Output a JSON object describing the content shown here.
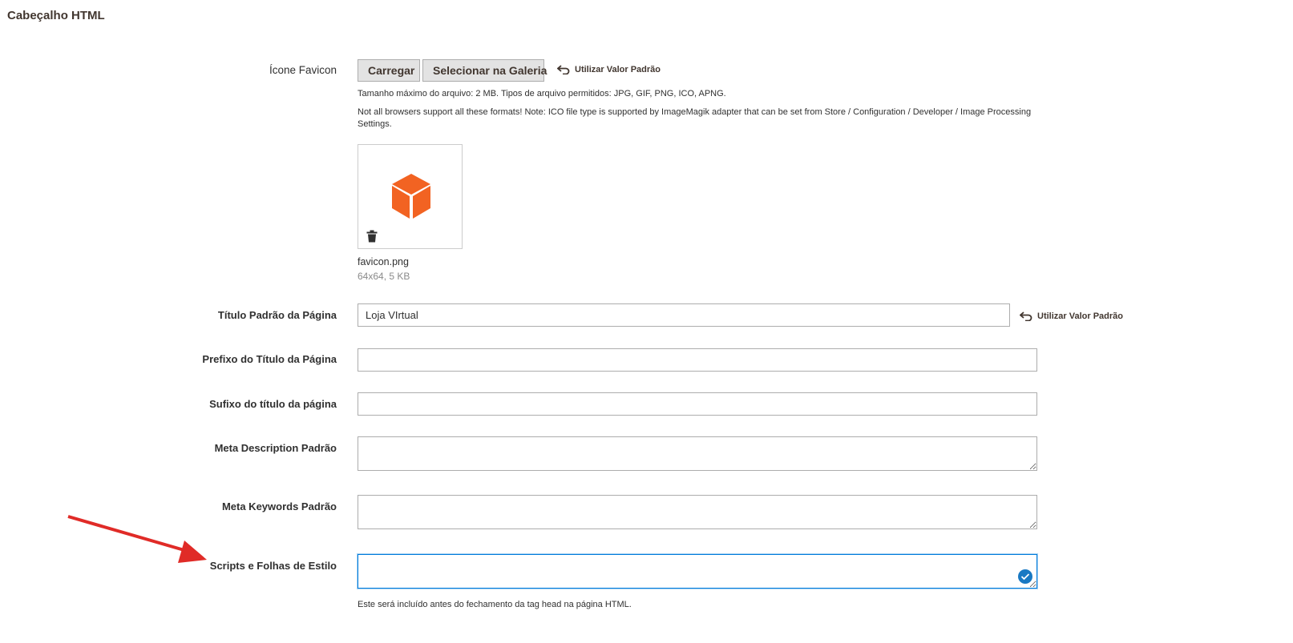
{
  "section": {
    "title": "Cabeçalho HTML"
  },
  "favicon": {
    "label": "Ícone Favicon",
    "upload_label": "Carregar",
    "gallery_label": "Selecionar na Galeria",
    "use_default_label": "Utilizar Valor Padrão",
    "size_note": "Tamanho máximo do arquivo: 2 MB. Tipos de arquivo permitidos: JPG, GIF, PNG, ICO, APNG.",
    "format_note": "Not all browsers support all these formats! Note: ICO file type is supported by ImageMagik adapter that can be set from Store / Configuration / Developer / Image Processing Settings.",
    "file_name": "favicon.png",
    "file_meta": "64x64, 5 KB"
  },
  "default_title": {
    "label": "Título Padrão da Página",
    "value": "Loja VIrtual",
    "use_default_label": "Utilizar Valor Padrão"
  },
  "title_prefix": {
    "label": "Prefixo do Título da Página",
    "value": ""
  },
  "title_suffix": {
    "label": "Sufixo do título da página",
    "value": ""
  },
  "meta_description": {
    "label": "Meta Description Padrão",
    "value": ""
  },
  "meta_keywords": {
    "label": "Meta Keywords Padrão",
    "value": ""
  },
  "scripts": {
    "label": "Scripts e Folhas de Estilo",
    "value": "",
    "note": "Este será incluído antes do fechamento da tag head na página HTML."
  },
  "colors": {
    "focus_border": "#007bdb",
    "check_badge": "#1979c3",
    "annotation_arrow": "#e02b27",
    "cube": "#f26322"
  },
  "icons": [
    "undo-icon",
    "cube-icon",
    "trash-icon",
    "check-icon",
    "arrow-annotation"
  ]
}
